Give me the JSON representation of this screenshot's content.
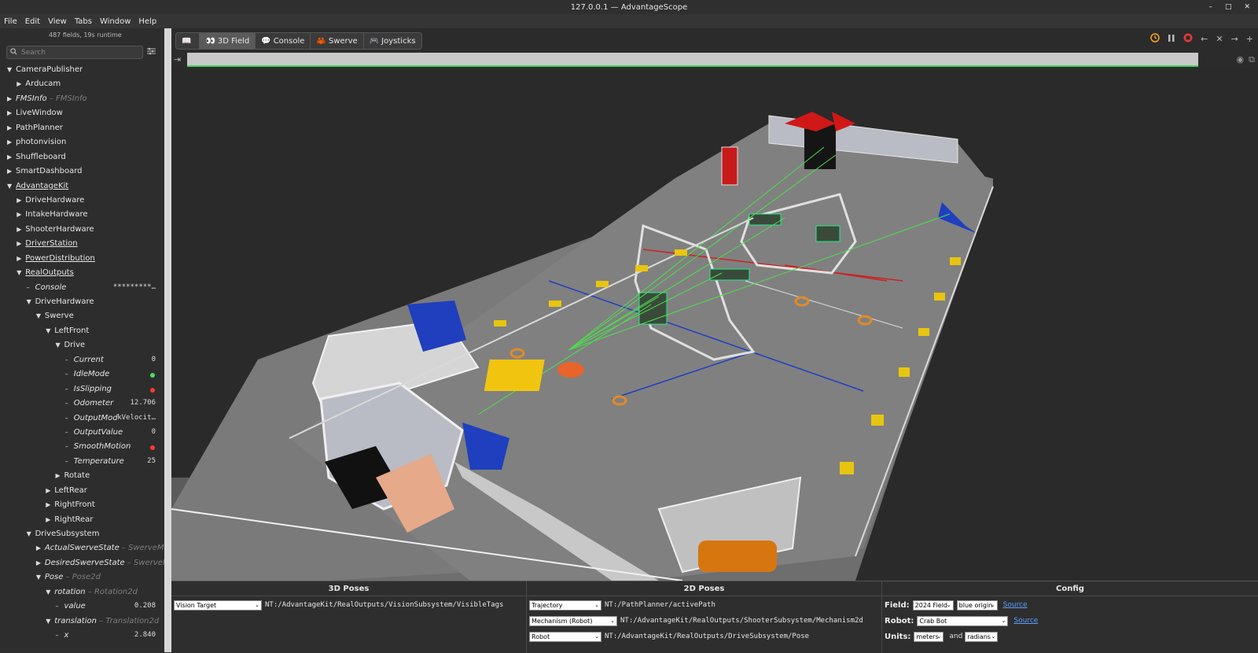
{
  "window": {
    "title": "127.0.0.1 — AdvantageScope",
    "controls": [
      "–",
      "□",
      "✕"
    ]
  },
  "menu": [
    "File",
    "Edit",
    "View",
    "Tabs",
    "Window",
    "Help"
  ],
  "sidebar": {
    "run_info": "487 fields, 19s runtime",
    "search_placeholder": "Search",
    "tree": [
      {
        "label": "CameraPublisher",
        "depth": 0,
        "arrow": "down"
      },
      {
        "label": "Arducam",
        "depth": 1,
        "arrow": "right"
      },
      {
        "label": "FMSInfo",
        "type": " – FMSInfo",
        "depth": 0,
        "arrow": "right",
        "italic": true
      },
      {
        "label": "LiveWindow",
        "depth": 0,
        "arrow": "right"
      },
      {
        "label": "PathPlanner",
        "depth": 0,
        "arrow": "right"
      },
      {
        "label": "photonvision",
        "depth": 0,
        "arrow": "right"
      },
      {
        "label": "Shuffleboard",
        "depth": 0,
        "arrow": "right"
      },
      {
        "label": "SmartDashboard",
        "depth": 0,
        "arrow": "right"
      },
      {
        "label": "AdvantageKit",
        "depth": 0,
        "arrow": "down",
        "underline": true
      },
      {
        "label": "DriveHardware",
        "depth": 1,
        "arrow": "right"
      },
      {
        "label": "IntakeHardware",
        "depth": 1,
        "arrow": "right"
      },
      {
        "label": "ShooterHardware",
        "depth": 1,
        "arrow": "right"
      },
      {
        "label": "DriverStation",
        "depth": 1,
        "arrow": "right",
        "underline": true
      },
      {
        "label": "PowerDistribution",
        "depth": 1,
        "arrow": "right",
        "underline": true
      },
      {
        "label": "RealOutputs",
        "depth": 1,
        "arrow": "down",
        "underline": true
      },
      {
        "label": "Console",
        "depth": 2,
        "arrow": "dash",
        "italic": true,
        "value": "*********…"
      },
      {
        "label": "DriveHardware",
        "depth": 2,
        "arrow": "down"
      },
      {
        "label": "Swerve",
        "depth": 3,
        "arrow": "down"
      },
      {
        "label": "LeftFront",
        "depth": 4,
        "arrow": "down"
      },
      {
        "label": "Drive",
        "depth": 5,
        "arrow": "down"
      },
      {
        "label": "Current",
        "depth": 6,
        "arrow": "dash",
        "italic": true,
        "value": "0"
      },
      {
        "label": "IdleMode",
        "depth": 6,
        "arrow": "dash",
        "italic": true,
        "dot": "#4cd964"
      },
      {
        "label": "IsSlipping",
        "depth": 6,
        "arrow": "dash",
        "italic": true,
        "dot": "#ff3b30"
      },
      {
        "label": "Odometer",
        "depth": 6,
        "arrow": "dash",
        "italic": true,
        "value": "12.706"
      },
      {
        "label": "OutputMod",
        "depth": 6,
        "arrow": "dash",
        "italic": true,
        "value": "kVelocit…"
      },
      {
        "label": "OutputValue",
        "depth": 6,
        "arrow": "dash",
        "italic": true,
        "value": "0"
      },
      {
        "label": "SmoothMotion",
        "depth": 6,
        "arrow": "dash",
        "italic": true,
        "dot": "#ff3b30"
      },
      {
        "label": "Temperature",
        "depth": 6,
        "arrow": "dash",
        "italic": true,
        "value": "25"
      },
      {
        "label": "Rotate",
        "depth": 5,
        "arrow": "right"
      },
      {
        "label": "LeftRear",
        "depth": 4,
        "arrow": "right"
      },
      {
        "label": "RightFront",
        "depth": 4,
        "arrow": "right"
      },
      {
        "label": "RightRear",
        "depth": 4,
        "arrow": "right"
      },
      {
        "label": "DriveSubsystem",
        "depth": 2,
        "arrow": "down"
      },
      {
        "label": "ActualSwerveState",
        "type": " – SwerveModu",
        "depth": 3,
        "arrow": "right",
        "italic": true
      },
      {
        "label": "DesiredSwerveState",
        "type": " – SwerveMod",
        "depth": 3,
        "arrow": "right",
        "italic": true
      },
      {
        "label": "Pose",
        "type": " – Pose2d",
        "depth": 3,
        "arrow": "down",
        "italic": true
      },
      {
        "label": "rotation",
        "type": " – Rotation2d",
        "depth": 4,
        "arrow": "down",
        "italic": true
      },
      {
        "label": "value",
        "depth": 5,
        "arrow": "dash",
        "italic": true,
        "value": "0.208"
      },
      {
        "label": "translation",
        "type": " – Translation2d",
        "depth": 4,
        "arrow": "down",
        "italic": true
      },
      {
        "label": "x",
        "depth": 5,
        "arrow": "dash",
        "italic": true,
        "value": "2.840"
      }
    ]
  },
  "tabs": [
    {
      "label": "",
      "icon": "📖"
    },
    {
      "label": "3D Field",
      "icon": "👀",
      "active": true
    },
    {
      "label": "Console",
      "icon": "💬"
    },
    {
      "label": "Swerve",
      "icon": "🦀"
    },
    {
      "label": "Joysticks",
      "icon": "🎮"
    }
  ],
  "bottom": {
    "poses3d": {
      "title": "3D Poses",
      "rows": [
        {
          "type": "Vision Target",
          "path": "NT:/AdvantageKit/RealOutputs/VisionSubsystem/VisibleTags"
        }
      ]
    },
    "poses2d": {
      "title": "2D Poses",
      "rows": [
        {
          "type": "Trajectory",
          "path": "NT:/PathPlanner/activePath"
        },
        {
          "type": "Mechanism (Robot)",
          "path": "NT:/AdvantageKit/RealOutputs/ShooterSubsystem/Mechanism2d"
        },
        {
          "type": "Robot",
          "path": "NT:/AdvantageKit/RealOutputs/DriveSubsystem/Pose"
        }
      ]
    },
    "config": {
      "title": "Config",
      "field_label": "Field:",
      "field_value": "2024 Field",
      "origin_value": "blue origin",
      "robot_label": "Robot:",
      "robot_value": "Crab Bot",
      "source_link": "Source",
      "units_label": "Units:",
      "units_length": "meters",
      "units_and": "and",
      "units_angle": "radians"
    }
  },
  "colors": {
    "accent_green": "#44d45a",
    "record_red": "#e53935",
    "live_orange": "#f5a623",
    "link_blue": "#5aa0ff"
  }
}
